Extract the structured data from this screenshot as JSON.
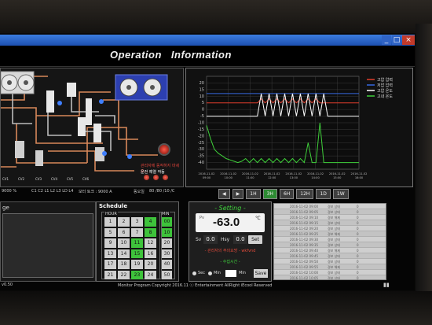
{
  "window": {
    "min": "_",
    "max": "□",
    "close": "×"
  },
  "header": {
    "title_a": "Operation",
    "title_b": "Information"
  },
  "schematic": {
    "unit_labels": [
      "CV1_1 CV1_2",
      "CV2_1 CV2_2",
      "CV3_1 CV3_2",
      "CV4_1 CV4_2",
      "CV5_1 CV5_2"
    ],
    "warning": "관리자에 동작하지 마세요...",
    "status": "운전 예열 작동"
  },
  "readout": {
    "left": "9000  %",
    "mid_labels": "C1  C2  L1  L2  L3  LD  L4",
    "center": "모터 토크 :  9000  A",
    "right_label": "동오일",
    "right_values": "80  /80  /10  /C"
  },
  "chart_data": {
    "type": "line",
    "x": [
      0,
      1,
      2,
      3,
      4,
      5,
      6,
      7,
      8,
      9,
      10,
      11,
      12,
      13,
      14,
      15,
      16,
      17,
      18,
      19,
      20,
      21,
      22,
      23,
      24,
      25,
      26,
      27,
      28,
      29,
      30,
      31,
      32,
      33,
      34,
      35,
      36,
      37,
      38,
      39
    ],
    "ylim": [
      -45,
      25
    ],
    "yticks": [
      20,
      15,
      10,
      5,
      0,
      -5,
      -10,
      -15,
      -20,
      -25,
      -30,
      -35,
      -40
    ],
    "x_tick_labels": [
      "2016-11-02\n09:00",
      "2016-11-02\n10:00",
      "2016-11-02\n11:00",
      "2016-11-02\n12:00",
      "2016-11-02\n13:00",
      "2016-11-02\n14:00",
      "2016-11-02\n15:00",
      "2016-11-02\n16:00"
    ],
    "series": [
      {
        "name": "고압 압력",
        "color": "#e13d2c",
        "values": [
          5,
          5,
          5,
          5,
          5,
          5,
          5,
          5,
          5,
          5,
          5,
          5,
          5,
          5,
          8,
          5,
          8,
          5,
          8,
          5,
          8,
          5,
          8,
          5,
          8,
          5,
          8,
          5,
          8,
          5,
          5,
          5,
          5,
          5,
          5,
          5,
          5,
          5,
          5,
          5
        ]
      },
      {
        "name": "저압 압력",
        "color": "#3569e0",
        "values": [
          12,
          12,
          12,
          12,
          12,
          12,
          12,
          12,
          12,
          12,
          12,
          12,
          12,
          12,
          12,
          12,
          12,
          12,
          12,
          12,
          12,
          12,
          12,
          12,
          12,
          12,
          12,
          12,
          12,
          12,
          12,
          12,
          12,
          12,
          12,
          12,
          12,
          12,
          12,
          12
        ]
      },
      {
        "name": "고압 온도",
        "color": "#ffffff",
        "values": [
          -5,
          -5,
          -5,
          -5,
          -5,
          -5,
          -5,
          -5,
          -5,
          -5,
          -5,
          -5,
          -5,
          -5,
          12,
          -5,
          12,
          -5,
          12,
          -5,
          12,
          -5,
          12,
          -5,
          12,
          -5,
          12,
          -5,
          12,
          -5,
          12,
          -5,
          -5,
          -5,
          -5,
          -5,
          -5,
          -5,
          -5,
          -5
        ]
      },
      {
        "name": "고내 온도",
        "color": "#3fcf3a",
        "values": [
          -12,
          -22,
          -30,
          -33,
          -35,
          -37,
          -38,
          -39,
          -40,
          -39,
          -37,
          -40,
          -37,
          -40,
          -37,
          -40,
          -37,
          -40,
          -37,
          -40,
          -37,
          -40,
          -37,
          -40,
          -37,
          -40,
          -25,
          -40,
          -40,
          -10,
          -40,
          -40,
          -40,
          -40,
          -40,
          -40,
          -40,
          -40,
          -40,
          -40
        ]
      }
    ]
  },
  "time_buttons": [
    "◀",
    "▶",
    "1H",
    "3H",
    "6H",
    "12H",
    "1D",
    "1W"
  ],
  "left_panel": {
    "title": "ge"
  },
  "schedule": {
    "title": "Schedule",
    "hour_label": "HOUR",
    "min_label": "MIN",
    "hours": [
      "1",
      "2",
      "3",
      "4",
      "5",
      "6",
      "7",
      "8",
      "9",
      "10",
      "11",
      "12",
      "13",
      "14",
      "15",
      "16",
      "17",
      "18",
      "19",
      "20",
      "21",
      "22",
      "23",
      "24"
    ],
    "hours_on": [
      3,
      7,
      10,
      14,
      22
    ],
    "mins": [
      "00",
      "10",
      "20",
      "30",
      "40",
      "50"
    ],
    "mins_on": [
      0,
      1
    ]
  },
  "setting": {
    "title": "- Setting -",
    "pv_label": "Pv",
    "pv_value": "-63.0",
    "unit": "℃",
    "sv_label": "Sv",
    "sv_value": "0.0",
    "hy_label": "Hsy",
    "hy_value": "0.0",
    "set_label": "Set",
    "warn": "- 관리자의 주의요망 - wkfvnd",
    "green": "- 수집시간 -",
    "opt_sec": "Sec",
    "opt_min": "Min",
    "input_value": "",
    "opt_min2": "Min",
    "save_label": "Save"
  },
  "log_rows": [
    {
      "time": "2016-11-02 09:00",
      "msg": "경보 상태",
      "val": "0"
    },
    {
      "time": "2016-11-02 09:05",
      "msg": "경보 상태",
      "val": "0"
    },
    {
      "time": "2016-11-02 09:10",
      "msg": "경보 해제",
      "val": "0"
    },
    {
      "time": "2016-11-02 09:15",
      "msg": "경보 상태",
      "val": "0"
    },
    {
      "time": "2016-11-02 09:20",
      "msg": "경보 상태",
      "val": "0"
    },
    {
      "time": "2016-11-02 09:25",
      "msg": "경보 해제",
      "val": "0"
    },
    {
      "time": "2016-11-02 09:30",
      "msg": "경보 상태",
      "val": "0"
    },
    {
      "time": "2016-11-02 09:35",
      "msg": "경보 상태",
      "val": "0"
    },
    {
      "time": "2016-11-02 09:40",
      "msg": "경보 해제",
      "val": "0"
    },
    {
      "time": "2016-11-02 09:45",
      "msg": "경보 상태",
      "val": "0"
    },
    {
      "time": "2016-11-02 09:50",
      "msg": "경보 상태",
      "val": "0"
    },
    {
      "time": "2016-11-02 09:55",
      "msg": "경보 해제",
      "val": "0"
    },
    {
      "time": "2016-11-02 10:00",
      "msg": "경보 상태",
      "val": "0"
    },
    {
      "time": "2016-11-02 10:05",
      "msg": "경보 상태",
      "val": "0"
    }
  ],
  "footer": {
    "text": "Monitor Program Copyright 2016.11 ⓒ Entertainment AllRight iEcool Reserved",
    "version": "v0.50",
    "mark": "▮▮"
  }
}
